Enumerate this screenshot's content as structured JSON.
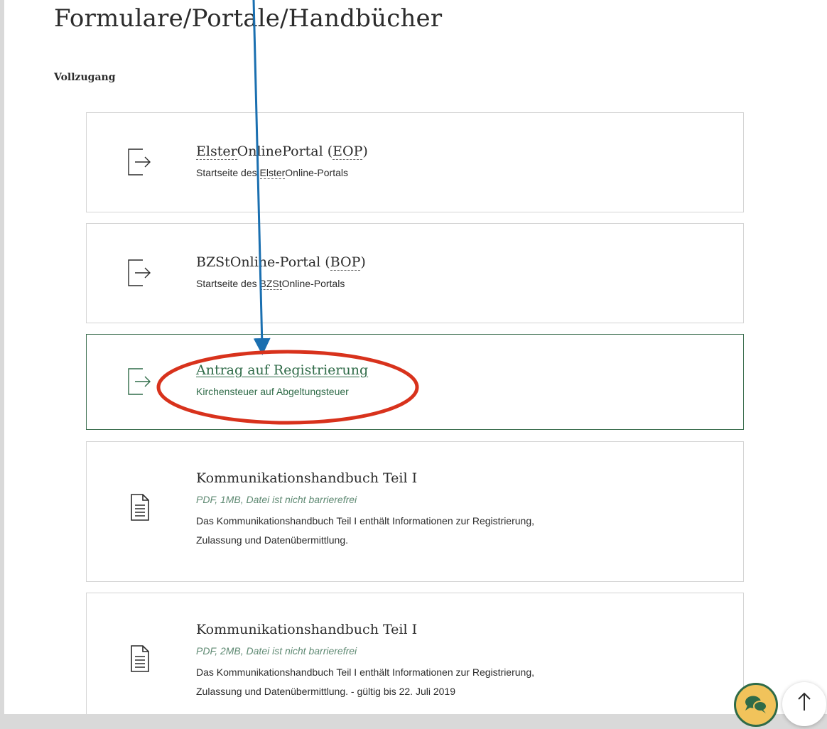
{
  "page": {
    "title": "Formulare/Portale/Handbücher",
    "section_label": "Vollzugang"
  },
  "cards": [
    {
      "title_parts": [
        "Elster",
        "OnlinePortal",
        " (",
        "EOP",
        ")"
      ],
      "subtitle_parts": [
        "Startseite des ",
        "Elster",
        "Online-Portals"
      ],
      "icon": "exit-arrow-icon"
    },
    {
      "title_parts": [
        "BZStOnline-Portal (",
        "BOP",
        ")"
      ],
      "subtitle_parts": [
        "Startseite des ",
        "BZSt",
        "Online-Portals"
      ],
      "icon": "exit-arrow-icon"
    },
    {
      "title": "Antrag auf Registrierung",
      "subtitle": "Kirchensteuer auf Abgeltungsteuer",
      "icon": "exit-arrow-icon"
    },
    {
      "title": "Kommunikationshandbuch Teil I",
      "meta": "PDF, 1MB, Datei ist nicht barrierefrei",
      "description_lines": [
        "Das Kommunikationshandbuch Teil I enthält Informationen zur Registrierung,",
        "Zulassung und Datenübermittlung."
      ],
      "icon": "document-icon"
    },
    {
      "title": "Kommunikationshandbuch Teil I",
      "meta": "PDF, 2MB, Datei ist nicht barrierefrei",
      "description_lines": [
        "Das Kommunikationshandbuch Teil I enthält Informationen zur Registrierung,",
        "Zulassung und Datenübermittlung. - gültig bis 22. Juli 2019"
      ],
      "icon": "document-icon"
    }
  ],
  "floating_buttons": {
    "chat_icon": "chat-bubbles-icon",
    "top_icon": "arrow-up-icon"
  },
  "colors": {
    "accent_green": "#2f6b48",
    "annotation_arrow": "#1a6fb0",
    "annotation_circle": "#d8321c",
    "chat_button_fill": "#f1c35b"
  }
}
